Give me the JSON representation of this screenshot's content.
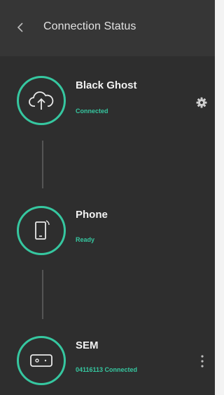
{
  "header": {
    "title": "Connection Status",
    "back_icon": "chevron-left-icon"
  },
  "accent_color": "#36c7a0",
  "nodes": [
    {
      "name": "Black Ghost",
      "status": "Connected",
      "icon": "cloud-upload-icon",
      "action_icon": "gear-icon"
    },
    {
      "name": "Phone",
      "status": "Ready",
      "icon": "phone-icon"
    },
    {
      "name": "SEM",
      "status": "04116113 Connected",
      "icon": "device-icon",
      "action_icon": "more-vertical-icon"
    }
  ]
}
